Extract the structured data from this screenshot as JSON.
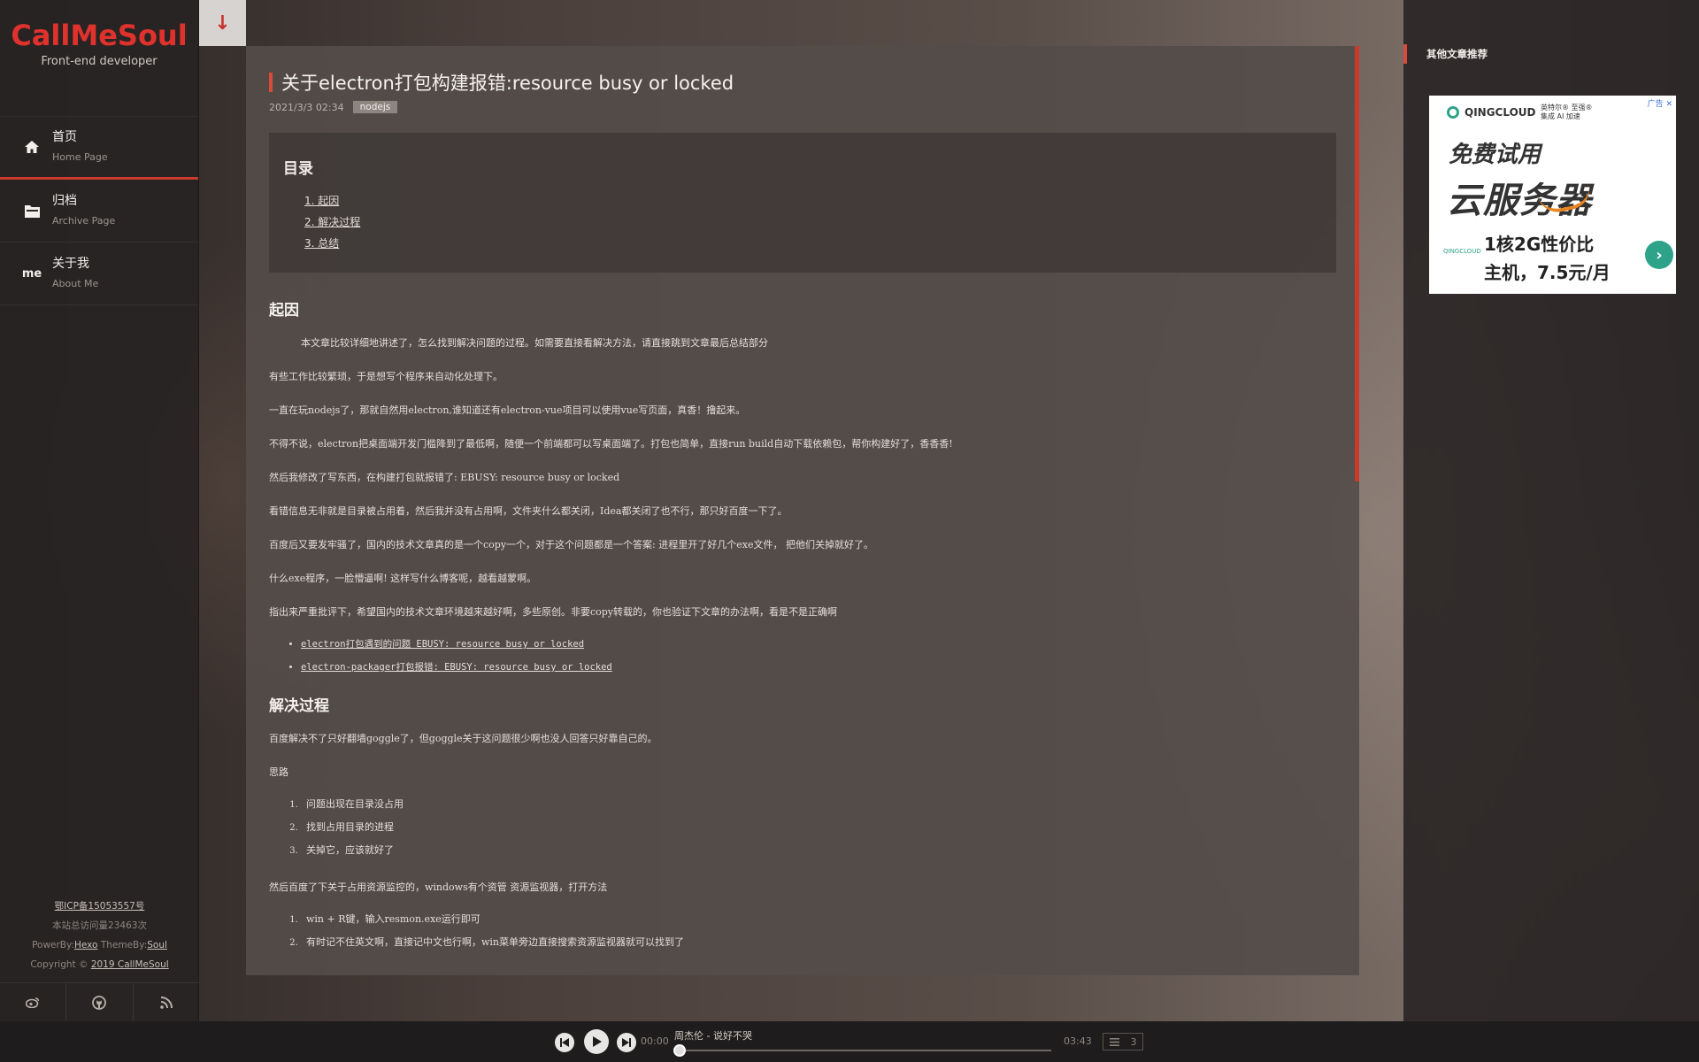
{
  "sidebar": {
    "logo": "CallMeSoul",
    "subtitle": "Front-end developer",
    "nav": [
      {
        "title": "首页",
        "sub": "Home Page",
        "icon": "home-icon"
      },
      {
        "title": "归档",
        "sub": "Archive Page",
        "icon": "folder-icon"
      },
      {
        "title": "关于我",
        "sub": "About Me",
        "icon": "me-icon",
        "icon_text": "me"
      }
    ],
    "footer": {
      "icp": "鄂ICP备15053557号",
      "visits": "本站总访问量23463次",
      "powered_prefix": "PowerBy:",
      "powered": "Hexo",
      "theme_prefix": " ThemeBy:",
      "theme": "Soul",
      "copyright_prefix": "Copyright © ",
      "copyright": "2019 CallMeSoul"
    },
    "social": [
      "weibo-icon",
      "github-icon",
      "rss-icon"
    ]
  },
  "scroll_button": "↓",
  "article": {
    "title": "关于electron打包构建报错:resource busy or locked",
    "date": "2021/3/3 02:34",
    "tag": "nodejs",
    "toc_title": "目录",
    "toc": [
      "1. 起因",
      "2. 解决过程",
      "3. 总结"
    ],
    "sections": {
      "cause_title": "起因",
      "cause_paras": [
        "本文章比较详细地讲述了，怎么找到解决问题的过程。如需要直接看解决方法，请直接跳到文章最后总结部分",
        "有些工作比较繁琐，于是想写个程序来自动化处理下。",
        "一直在玩nodejs了，那就自然用electron,谁知道还有electron-vue项目可以使用vue写页面，真香！撸起来。",
        "不得不说，electron把桌面端开发门槛降到了最低啊，随便一个前端都可以写桌面端了。打包也简单，直接run build自动下载依赖包，帮你构建好了，香香香!",
        "然后我修改了写东西，在构建打包就报错了: EBUSY: resource busy or locked",
        "看错信息无非就是目录被占用着，然后我并没有占用啊，文件夹什么都关闭，Idea都关闭了也不行，那只好百度一下了。",
        "百度后又要发牢骚了，国内的技术文章真的是一个copy一个，对于这个问题都是一个答案: 进程里开了好几个exe文件， 把他们关掉就好了。",
        "什么exe程序，一脸懵逼啊! 这样写什么博客呢，越看越蒙啊。",
        "指出来严重批评下，希望国内的技术文章环境越来越好啊，多些原创。非要copy转载的，你也验证下文章的办法啊，看是不是正确啊"
      ],
      "cause_links": [
        "electron打包遇到的问题 EBUSY: resource busy or locked",
        "electron-packager打包报错: EBUSY: resource busy or locked"
      ],
      "solve_title": "解决过程",
      "solve_para1": "百度解决不了只好翻墙goggle了，但goggle关于这问题很少啊也没人回答只好靠自己的。",
      "solve_para2": "思路",
      "solve_steps": [
        "问题出现在目录没占用",
        "找到占用目录的进程",
        "关掉它，应该就好了"
      ],
      "solve_para3": "然后百度了下关于占用资源监控的，windows有个资管 资源监视器，打开方法",
      "open_steps": [
        "win + R键，输入resmon.exe运行即可",
        "有时记不住英文啊，直接记中文也行啊，win菜单旁边直接搜索资源监视器就可以找到了"
      ]
    }
  },
  "right_panel": {
    "title": "其他文章推荐",
    "ad": {
      "label": "广告 ✕",
      "brand1": "QINGCLOUD",
      "brand2_line1": "英特尔® 至强®",
      "brand2_line2": "集成 AI 加速",
      "head1": "免费试用",
      "head2": "云服务器",
      "qc": "QINGCLOUD",
      "body_line1": "1核2G性价比",
      "body_line2": "主机，7.5元/月"
    }
  },
  "player": {
    "song": "周杰伦 - 说好不哭",
    "current": "00:00",
    "duration": "03:43",
    "playlist_count": "3",
    "progress": 0
  }
}
